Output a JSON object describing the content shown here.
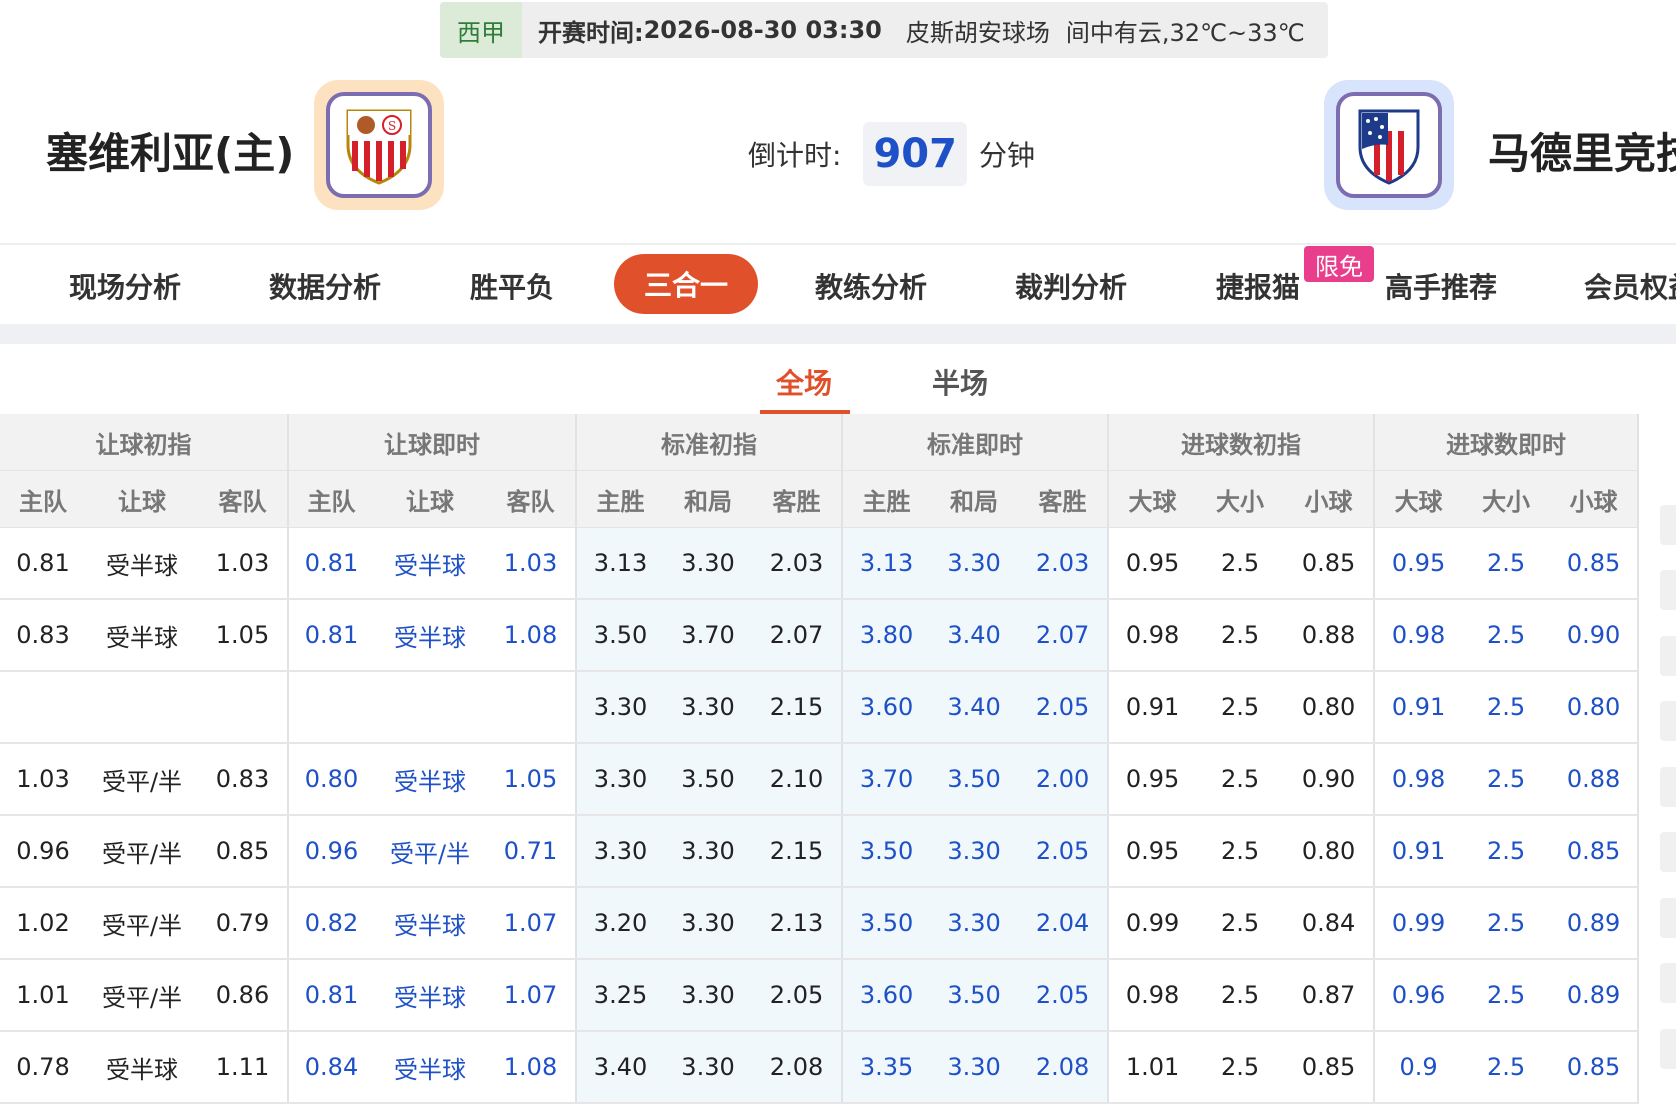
{
  "match": {
    "league": "西甲",
    "kickoff_label": "开赛时间:",
    "kickoff_time": "2026-08-30 03:30",
    "venue": "皮斯胡安球场",
    "weather": "间中有云,32℃~33℃"
  },
  "home_team": {
    "name": "塞维利亚(主)"
  },
  "away_team": {
    "name": "马德里竞技"
  },
  "countdown": {
    "label": "倒计时:",
    "value": "907",
    "unit": "分钟"
  },
  "nav": {
    "tabs": [
      "现场分析",
      "数据分析",
      "胜平负",
      "三合一",
      "教练分析",
      "裁判分析",
      "捷报猫",
      "高手推荐",
      "会员权益"
    ],
    "active_index": 3,
    "free_badge": "限免"
  },
  "sub_tabs": {
    "full": "全场",
    "half": "半场",
    "active": "full"
  },
  "table": {
    "groups": [
      "让球初指",
      "让球即时",
      "标准初指",
      "标准即时",
      "进球数初指",
      "进球数即时"
    ],
    "subheaders": [
      "主队",
      "让球",
      "客队",
      "主队",
      "让球",
      "客队",
      "主胜",
      "和局",
      "客胜",
      "主胜",
      "和局",
      "客胜",
      "大球",
      "大小",
      "小球",
      "大球",
      "大小",
      "小球"
    ],
    "rows": [
      [
        "0.81",
        "受半球",
        "1.03",
        "0.81",
        "受半球",
        "1.03",
        "3.13",
        "3.30",
        "2.03",
        "3.13",
        "3.30",
        "2.03",
        "0.95",
        "2.5",
        "0.85",
        "0.95",
        "2.5",
        "0.85"
      ],
      [
        "0.83",
        "受半球",
        "1.05",
        "0.81",
        "受半球",
        "1.08",
        "3.50",
        "3.70",
        "2.07",
        "3.80",
        "3.40",
        "2.07",
        "0.98",
        "2.5",
        "0.88",
        "0.98",
        "2.5",
        "0.90"
      ],
      [
        "",
        "",
        "",
        "",
        "",
        "",
        "3.30",
        "3.30",
        "2.15",
        "3.60",
        "3.40",
        "2.05",
        "0.91",
        "2.5",
        "0.80",
        "0.91",
        "2.5",
        "0.80"
      ],
      [
        "1.03",
        "受平/半",
        "0.83",
        "0.80",
        "受半球",
        "1.05",
        "3.30",
        "3.50",
        "2.10",
        "3.70",
        "3.50",
        "2.00",
        "0.95",
        "2.5",
        "0.90",
        "0.98",
        "2.5",
        "0.88"
      ],
      [
        "0.96",
        "受平/半",
        "0.85",
        "0.96",
        "受平/半",
        "0.71",
        "3.30",
        "3.30",
        "2.15",
        "3.50",
        "3.30",
        "2.05",
        "0.95",
        "2.5",
        "0.80",
        "0.91",
        "2.5",
        "0.85"
      ],
      [
        "1.02",
        "受平/半",
        "0.79",
        "0.82",
        "受半球",
        "1.07",
        "3.20",
        "3.30",
        "2.13",
        "3.50",
        "3.30",
        "2.04",
        "0.99",
        "2.5",
        "0.84",
        "0.99",
        "2.5",
        "0.89"
      ],
      [
        "1.01",
        "受平/半",
        "0.86",
        "0.81",
        "受半球",
        "1.07",
        "3.25",
        "3.30",
        "2.05",
        "3.60",
        "3.50",
        "2.05",
        "0.98",
        "2.5",
        "0.87",
        "0.96",
        "2.5",
        "0.89"
      ],
      [
        "0.78",
        "受半球",
        "1.11",
        "0.84",
        "受半球",
        "1.08",
        "3.40",
        "3.30",
        "2.08",
        "3.35",
        "3.30",
        "2.08",
        "1.01",
        "2.5",
        "0.85",
        "0.9",
        "2.5",
        "0.85"
      ]
    ]
  },
  "colors": {
    "accent": "#e0512b",
    "live_blue": "#1e50c8",
    "badge_pink": "#e83e8c"
  }
}
